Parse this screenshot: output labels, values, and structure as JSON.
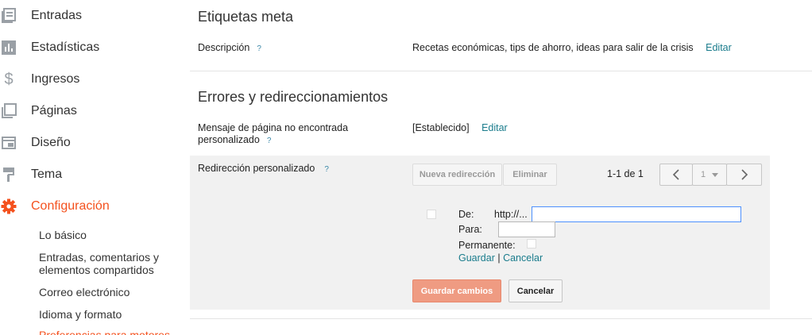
{
  "sidebar": {
    "items": [
      {
        "label": "Entradas",
        "icon": "posts-icon"
      },
      {
        "label": "Estadísticas",
        "icon": "stats-icon"
      },
      {
        "label": "Ingresos",
        "icon": "dollar-icon"
      },
      {
        "label": "Páginas",
        "icon": "pages-icon"
      },
      {
        "label": "Diseño",
        "icon": "layout-icon"
      },
      {
        "label": "Tema",
        "icon": "paint-roller-icon"
      },
      {
        "label": "Configuración",
        "icon": "gear-icon"
      }
    ],
    "subitems": [
      {
        "label": "Lo básico"
      },
      {
        "label": "Entradas, comentarios y"
      },
      {
        "label": "elementos compartidos"
      },
      {
        "label": "Correo electrónico"
      },
      {
        "label": "Idioma y formato"
      },
      {
        "label": "Preferencias para motores"
      }
    ]
  },
  "meta": {
    "title": "Etiquetas meta",
    "description_label": "Descripción",
    "description_value": "Recetas económicas, tips de ahorro, ideas para salir de la crisis",
    "edit": "Editar"
  },
  "errors": {
    "title": "Errores y redireccionamientos",
    "notfound_label_line1": "Mensaje de página no encontrada",
    "notfound_label_line2": "personalizado",
    "notfound_value": "[Establecido]",
    "edit": "Editar",
    "redirect_label": "Redirección personalizado",
    "help": "?"
  },
  "redirect": {
    "new_button": "Nueva redirección",
    "delete_button": "Eliminar",
    "pager_text": "1-1 de 1",
    "page_select": "1",
    "from_label": "De:",
    "from_prefix": "http://...",
    "to_label": "Para:",
    "permanent_label": "Permanente:",
    "save_link": "Guardar",
    "separator": "|",
    "cancel_link": "Cancelar"
  },
  "footer": {
    "save_changes": "Guardar cambios",
    "cancel": "Cancelar"
  },
  "colors": {
    "accent": "#f4511e",
    "link": "#1a7c8c",
    "primary_button": "#ef9b82"
  }
}
